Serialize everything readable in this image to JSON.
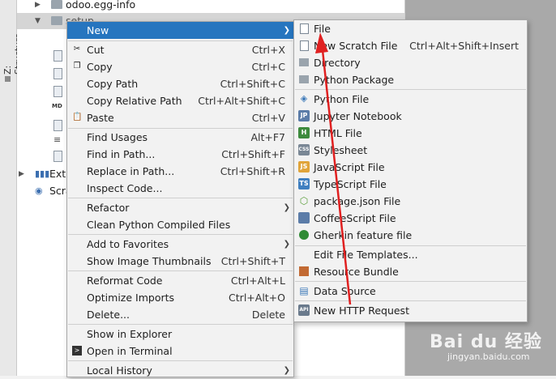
{
  "toolwindow": {
    "structure_label": "Z: Structure"
  },
  "tree": {
    "rows": [
      {
        "label": "odoo.egg-info"
      },
      {
        "label": "setup"
      },
      {
        "label": "Exte"
      },
      {
        "label": "Scra"
      }
    ]
  },
  "context_menu": {
    "items": [
      {
        "label": "New",
        "shortcut": ""
      },
      {
        "label": "Cut",
        "shortcut": "Ctrl+X"
      },
      {
        "label": "Copy",
        "shortcut": "Ctrl+C"
      },
      {
        "label": "Copy Path",
        "shortcut": "Ctrl+Shift+C"
      },
      {
        "label": "Copy Relative Path",
        "shortcut": "Ctrl+Alt+Shift+C"
      },
      {
        "label": "Paste",
        "shortcut": "Ctrl+V"
      },
      {
        "label": "Find Usages",
        "shortcut": "Alt+F7"
      },
      {
        "label": "Find in Path...",
        "shortcut": "Ctrl+Shift+F"
      },
      {
        "label": "Replace in Path...",
        "shortcut": "Ctrl+Shift+R"
      },
      {
        "label": "Inspect Code...",
        "shortcut": ""
      },
      {
        "label": "Refactor",
        "shortcut": ""
      },
      {
        "label": "Clean Python Compiled Files",
        "shortcut": ""
      },
      {
        "label": "Add to Favorites",
        "shortcut": ""
      },
      {
        "label": "Show Image Thumbnails",
        "shortcut": "Ctrl+Shift+T"
      },
      {
        "label": "Reformat Code",
        "shortcut": "Ctrl+Alt+L"
      },
      {
        "label": "Optimize Imports",
        "shortcut": "Ctrl+Alt+O"
      },
      {
        "label": "Delete...",
        "shortcut": "Delete"
      },
      {
        "label": "Show in Explorer",
        "shortcut": ""
      },
      {
        "label": "Open in Terminal",
        "shortcut": ""
      },
      {
        "label": "Local History",
        "shortcut": ""
      }
    ]
  },
  "new_submenu": {
    "items": [
      {
        "label": "File",
        "shortcut": ""
      },
      {
        "label": "New Scratch File",
        "shortcut": "Ctrl+Alt+Shift+Insert"
      },
      {
        "label": "Directory",
        "shortcut": ""
      },
      {
        "label": "Python Package",
        "shortcut": ""
      },
      {
        "label": "Python File",
        "shortcut": ""
      },
      {
        "label": "Jupyter Notebook",
        "shortcut": ""
      },
      {
        "label": "HTML File",
        "shortcut": ""
      },
      {
        "label": "Stylesheet",
        "shortcut": ""
      },
      {
        "label": "JavaScript File",
        "shortcut": ""
      },
      {
        "label": "TypeScript File",
        "shortcut": ""
      },
      {
        "label": "package.json File",
        "shortcut": ""
      },
      {
        "label": "CoffeeScript File",
        "shortcut": ""
      },
      {
        "label": "Gherkin feature file",
        "shortcut": ""
      },
      {
        "label": "Edit File Templates...",
        "shortcut": ""
      },
      {
        "label": "Resource Bundle",
        "shortcut": ""
      },
      {
        "label": "Data Source",
        "shortcut": ""
      },
      {
        "label": "New HTTP Request",
        "shortcut": ""
      }
    ],
    "icon_labels": {
      "jupyter": "JP",
      "html": "H",
      "css": "CSS",
      "js": "JS",
      "ts": "TS",
      "api": "API"
    }
  },
  "watermark": {
    "brand": "Bai du 经验",
    "url": "jingyan.baidu.com"
  },
  "colors": {
    "highlight": "#2675bf",
    "menu_bg": "#f2f2f2",
    "arrow": "#e02020"
  }
}
